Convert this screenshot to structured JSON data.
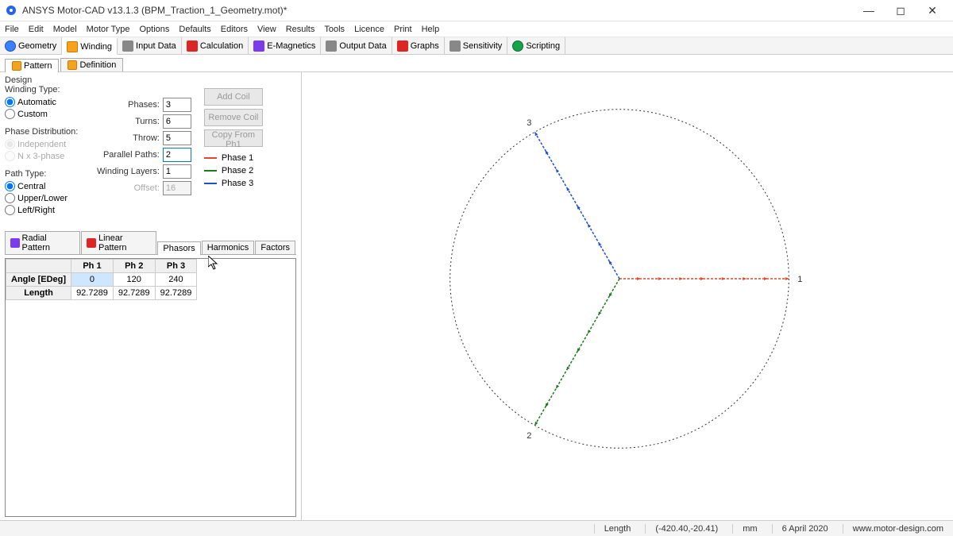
{
  "window": {
    "title": "ANSYS Motor-CAD v13.1.3 (BPM_Traction_1_Geometry.mot)*"
  },
  "menu": [
    "File",
    "Edit",
    "Model",
    "Motor Type",
    "Options",
    "Defaults",
    "Editors",
    "View",
    "Results",
    "Tools",
    "Licence",
    "Print",
    "Help"
  ],
  "toolbar": {
    "items": [
      {
        "label": "Geometry",
        "icon": "ic-blue"
      },
      {
        "label": "Winding",
        "icon": "ic-orange",
        "active": true
      },
      {
        "label": "Input Data",
        "icon": "ic-gray"
      },
      {
        "label": "Calculation",
        "icon": "ic-red"
      },
      {
        "label": "E-Magnetics",
        "icon": "ic-purple"
      },
      {
        "label": "Output Data",
        "icon": "ic-gray"
      },
      {
        "label": "Graphs",
        "icon": "ic-red"
      },
      {
        "label": "Sensitivity",
        "icon": "ic-gray"
      },
      {
        "label": "Scripting",
        "icon": "ic-green"
      }
    ]
  },
  "subtabs": [
    {
      "label": "Pattern",
      "active": true
    },
    {
      "label": "Definition"
    }
  ],
  "design": {
    "heading": "Design",
    "winding_type_label": "Winding Type:",
    "winding_type_options": [
      "Automatic",
      "Custom"
    ],
    "winding_type_selected": "Automatic",
    "phase_dist_label": "Phase Distribution:",
    "phase_dist_options": [
      "Independent",
      "N x 3-phase"
    ],
    "path_type_label": "Path Type:",
    "path_type_options": [
      "Central",
      "Upper/Lower",
      "Left/Right"
    ],
    "path_type_selected": "Central",
    "fields": {
      "phases": {
        "label": "Phases:",
        "value": "3"
      },
      "turns": {
        "label": "Turns:",
        "value": "6"
      },
      "throw": {
        "label": "Throw:",
        "value": "5"
      },
      "parallel_paths": {
        "label": "Parallel Paths:",
        "value": "2",
        "active": true
      },
      "winding_layers": {
        "label": "Winding Layers:",
        "value": "1"
      },
      "offset": {
        "label": "Offset:",
        "value": "16",
        "disabled": true
      }
    },
    "buttons": [
      "Add Coil",
      "Remove Coil",
      "Copy From Ph1"
    ],
    "legend": [
      {
        "label": "Phase 1",
        "color": "#e8452a"
      },
      {
        "label": "Phase 2",
        "color": "#1c7a1c"
      },
      {
        "label": "Phase 3",
        "color": "#1d4ed8"
      }
    ]
  },
  "pattern_tabs": [
    {
      "label": "Radial Pattern"
    },
    {
      "label": "Linear Pattern"
    },
    {
      "label": "Phasors",
      "active": true
    },
    {
      "label": "Harmonics"
    },
    {
      "label": "Factors"
    }
  ],
  "table": {
    "cols": [
      "Ph 1",
      "Ph 2",
      "Ph 3"
    ],
    "rows": [
      {
        "hdr": "Angle [EDeg]",
        "cells": [
          "0",
          "120",
          "240"
        ],
        "selected": 0
      },
      {
        "hdr": "Length",
        "cells": [
          "92.7289",
          "92.7289",
          "92.7289"
        ]
      }
    ]
  },
  "chart_data": {
    "type": "scatter",
    "title": "",
    "xlabel": "",
    "ylabel": "",
    "xlim": [
      -100,
      100
    ],
    "ylim": [
      -100,
      100
    ],
    "series": [
      {
        "name": "Phase 1",
        "color": "#e8452a",
        "angle_deg": 0,
        "length": 92.7289,
        "arrow_count": 8,
        "end_label": "1"
      },
      {
        "name": "Phase 2",
        "color": "#1c7a1c",
        "angle_deg": 240,
        "length": 92.7289,
        "arrow_count": 8,
        "end_label": "2"
      },
      {
        "name": "Phase 3",
        "color": "#1d4ed8",
        "angle_deg": 120,
        "length": 92.7289,
        "arrow_count": 8,
        "end_label": "3"
      }
    ],
    "circle_radius": 92.7289
  },
  "status": {
    "mode": "Length",
    "coords": "(-420.40,-20.41)",
    "units": "mm",
    "date": "6 April 2020",
    "url": "www.motor-design.com"
  }
}
